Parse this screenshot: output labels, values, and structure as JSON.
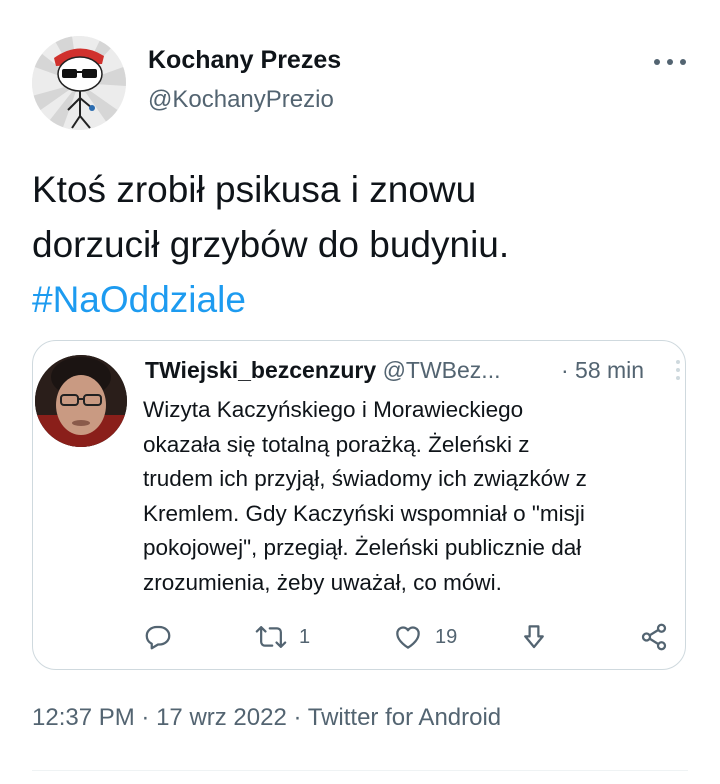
{
  "tweet": {
    "author": {
      "name": "Kochany Prezes",
      "handle": "@KochanyPrezio"
    },
    "text_lines": [
      "Ktoś zrobił psikusa i znowu",
      "dorzucił grzybów do budyniu."
    ],
    "hashtag": "#NaOddziale",
    "meta": {
      "time": "12:37 PM",
      "separator": "·",
      "date": "17 wrz 2022",
      "source": "Twitter for Android"
    }
  },
  "quoted_tweet": {
    "author": {
      "name": "TWiejski_bezcenzury",
      "handle": "@TWBez...",
      "time": "· 58 min"
    },
    "text_lines": [
      "Wizyta Kaczyńskiego i Morawieckiego",
      "okazała się totalną porażką. Żeleński z",
      "trudem ich przyjął, świadomy ich związków z",
      "Kremlem. Gdy Kaczyński wspomniał o \"misji",
      "pokojowej\", przegiął. Żeleński publicznie dał",
      "zrozumienia, żeby uważał, co mówi."
    ],
    "actions": {
      "reply_icon": "reply-icon",
      "retweet_icon": "retweet-icon",
      "retweet_count": "1",
      "like_icon": "heart-icon",
      "like_count": "19",
      "download_icon": "download-icon",
      "share_icon": "share-icon"
    }
  },
  "colors": {
    "text": "#0f1419",
    "secondary": "#536471",
    "link": "#1d9bf0",
    "border": "#cfd9de"
  }
}
